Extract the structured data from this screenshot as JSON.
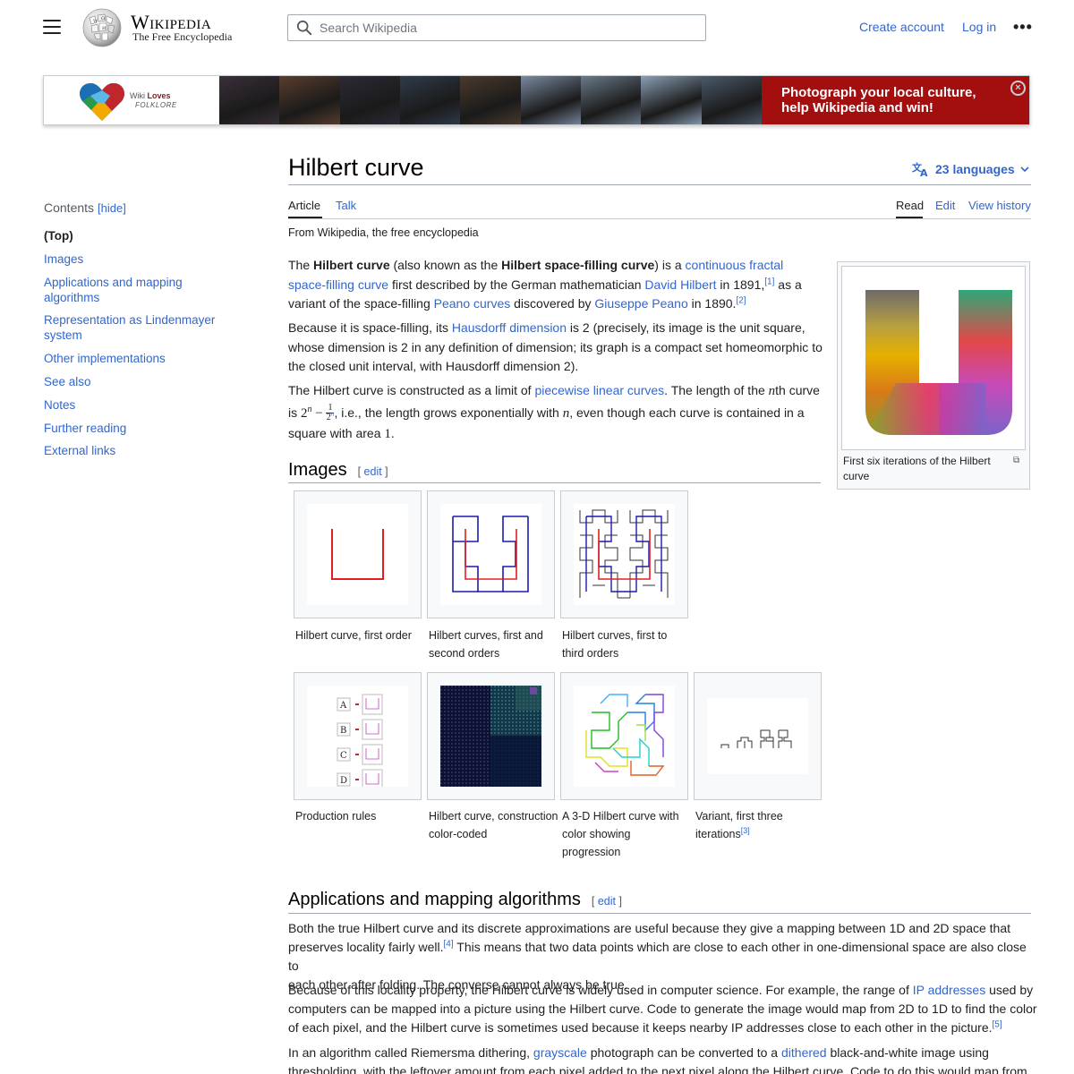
{
  "header": {
    "wordmark": "Wikipedia",
    "tagline": "The Free Encyclopedia",
    "search_placeholder": "Search Wikipedia",
    "create_account": "Create account",
    "log_in": "Log in",
    "more": "•••"
  },
  "banner": {
    "brand_wiki": "Wiki",
    "brand_loves": "Loves",
    "brand_folklore": "FOLKLORE",
    "cta_line1": "Photograph your local culture,",
    "cta_line2": "help Wikipedia and win!",
    "close": "×",
    "photo_colors": [
      "#3a2f3a",
      "#5a3d2e",
      "#2d2a35",
      "#2f3b4a",
      "#4a3a2d",
      "#7a8aa0",
      "#6a7a8a",
      "#8a9fb5",
      "#4a5a6a"
    ]
  },
  "toc": {
    "title": "Contents",
    "hide": "[hide]",
    "items": [
      "(Top)",
      "Images",
      "Applications and mapping algorithms",
      "Representation as Lindenmayer system",
      "Other implementations",
      "See also",
      "Notes",
      "Further reading",
      "External links"
    ]
  },
  "article": {
    "title": "Hilbert curve",
    "languages": "23 languages",
    "tabs": {
      "article": "Article",
      "talk": "Talk",
      "read": "Read",
      "edit": "Edit",
      "history": "View history"
    },
    "from": "From Wikipedia, the free encyclopedia",
    "p1": {
      "t1": "The ",
      "b1": "Hilbert curve",
      "t2": " (also known as the ",
      "b2": "Hilbert space-filling curve",
      "t3": ") is a ",
      "l1": "continuous fractal",
      "l2": "space-filling curve",
      "t4": " first described by the German mathematician ",
      "l3": "David Hilbert",
      "t5": " in 1891,",
      "r1": "[1]",
      "t6": " as a",
      "t7": "variant of the space-filling ",
      "l4": "Peano curves",
      "t8": " discovered by ",
      "l5": "Giuseppe Peano",
      "t9": " in 1890.",
      "r2": "[2]"
    },
    "p2": {
      "t1": "Because it is space-filling, its ",
      "l1": "Hausdorff dimension",
      "t2": " is 2 (precisely, its image is the unit square,",
      "t3": "whose dimension is 2 in any definition of dimension; its graph is a compact set homeomorphic to",
      "t4": "the closed unit interval, with Hausdorff dimension 2)."
    },
    "p3": {
      "t1": "The Hilbert curve is constructed as a limit of ",
      "l1": "piecewise linear curves",
      "t2": ". The length of the ",
      "m1": "n",
      "t3": "th curve",
      "t4": "is ",
      "m2": "2",
      "m2sup": "n",
      "m3": " − ",
      "fnum": "1",
      "fden": "2",
      "fdensup": "n",
      "t5": ", i.e., the length grows exponentially with ",
      "m4": "n",
      "t6": ", even though each curve is contained in a",
      "t7": "square with area ",
      "m5": "1",
      "t8": "."
    },
    "thumb_caption": "First six iterations of the Hilbert curve",
    "images_heading": "Images",
    "edit_open": "[ ",
    "edit_label": "edit",
    "edit_close": " ]",
    "gallery": [
      {
        "caption": "Hilbert curve, first order",
        "ref": ""
      },
      {
        "caption": "Hilbert curves, first and second orders",
        "ref": ""
      },
      {
        "caption": "Hilbert curves, first to third orders",
        "ref": ""
      },
      {
        "caption": "Production rules",
        "ref": ""
      },
      {
        "caption": "Hilbert curve, construction color-coded",
        "ref": ""
      },
      {
        "caption": "A 3-D Hilbert curve with color showing progression",
        "ref": ""
      },
      {
        "caption": "Variant, first three iterations",
        "ref": "[3]"
      }
    ],
    "production_letters": [
      "A",
      "B",
      "C",
      "D"
    ],
    "apps_heading": "Applications and mapping algorithms",
    "p4": {
      "t1": "Both the true Hilbert curve and its discrete approximations are useful because they give a mapping between 1D and 2D space that",
      "t2": "preserves locality fairly well.",
      "r1": "[4]",
      "t3": " This means that two data points which are close to each other in one-dimensional space are also close to",
      "t4": "each other after folding. The converse cannot always be true."
    },
    "p5": {
      "t1": "Because of this locality property, the Hilbert curve is widely used in computer science. For example, the range of ",
      "l1": "IP addresses",
      "t2": " used by",
      "t3": "computers can be mapped into a picture using the Hilbert curve. Code to generate the image would map from 2D to 1D to find the color",
      "t4": "of each pixel, and the Hilbert curve is sometimes used because it keeps nearby IP addresses close to each other in the picture.",
      "r1": "[5]"
    },
    "p6": {
      "t1": "In an algorithm called Riemersma dithering, ",
      "l1": "grayscale",
      "t2": " photograph can be converted to a ",
      "l2": "dithered",
      "t3": " black-and-white image using",
      "t4": "thresholding, with the leftover amount from each pixel added to the next pixel along the Hilbert curve. Code to do this would map from"
    }
  }
}
